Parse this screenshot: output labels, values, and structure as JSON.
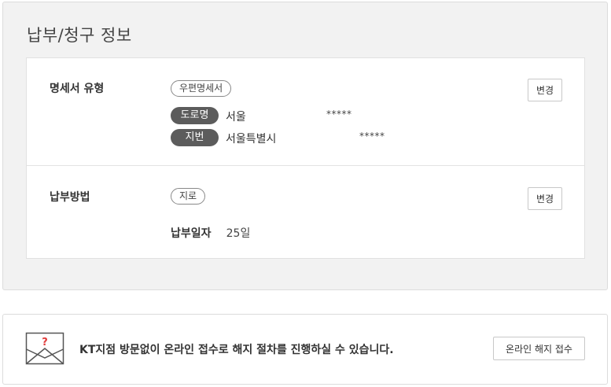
{
  "billing": {
    "title": "납부/청구 정보",
    "statement": {
      "label": "명세서 유형",
      "type_badge": "우편명세서",
      "change_label": "변경",
      "road_address": {
        "tag": "도로명",
        "text": "서울",
        "masked": "*****"
      },
      "lot_address": {
        "tag": "지번",
        "text": "서울특별시",
        "masked": "*****"
      }
    },
    "payment": {
      "label": "납부방법",
      "method_badge": "지로",
      "change_label": "변경",
      "due_label": "납부일자",
      "due_value": "25일"
    }
  },
  "termination": {
    "message": "KT지점 방문없이 온라인 접수로 해지 절차를 진행하실 수 있습니다.",
    "button_label": "온라인 해지 접수",
    "icon_accent": "#e03b3b"
  }
}
